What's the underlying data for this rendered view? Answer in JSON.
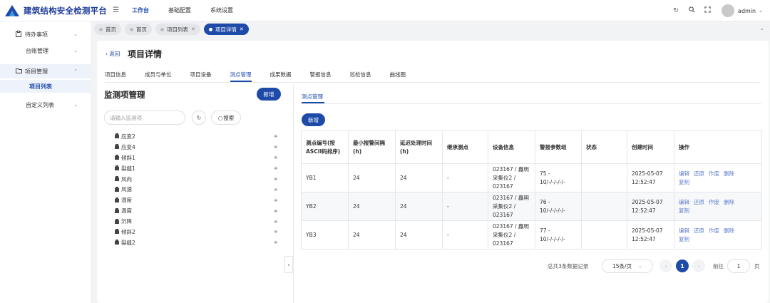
{
  "header": {
    "brand": "建筑结构安全检测平台",
    "nav": [
      "工作台",
      "基础配置",
      "系统设置"
    ],
    "username": "admin",
    "colors": {
      "primary": "#1f4ba8",
      "brand_text": "#1f3d9c"
    }
  },
  "sidebar": {
    "items": [
      {
        "label": "待办事项",
        "icon": "clipboard-icon"
      },
      {
        "label": "台账管理"
      },
      {
        "label": "项目管理",
        "icon": "folder-icon"
      },
      {
        "label": "项目列表"
      },
      {
        "label": "自定义列表"
      }
    ]
  },
  "tags": [
    {
      "label": "首页"
    },
    {
      "label": "首页"
    },
    {
      "label": "项目列表"
    },
    {
      "label": "项目详情"
    }
  ],
  "page": {
    "back_label": "返回",
    "title": "项目详情",
    "tabs": [
      "项目信息",
      "成员与单位",
      "项目设备",
      "测点管理",
      "成果数据",
      "警报信息",
      "巡检信息",
      "曲线图"
    ]
  },
  "left_panel": {
    "title": "监测项管理",
    "add_label": "新增",
    "search_placeholder": "请输入监测项",
    "search_label": "搜索",
    "tree": [
      "应变2",
      "应变4",
      "倾斜1",
      "裂缝1",
      "风向",
      "风速",
      "湿度",
      "温度",
      "沉降",
      "倾斜2",
      "裂缝2"
    ]
  },
  "right_panel": {
    "tab": "测点管理",
    "add_label": "新增",
    "columns": [
      "测点编号(按ASCII码排序)",
      "最小报警间隔(h)",
      "延迟处理时间(h)",
      "继承测点",
      "设备信息",
      "警报参数组",
      "状态",
      "创建时间",
      "操作"
    ],
    "rows": [
      {
        "code": "YB1",
        "min_interval": "24",
        "delay": "24",
        "inherit": "-",
        "device": "023167 / 矗明采集仪2 / 023167",
        "params": "75 - 10/-/-/-/-/-",
        "status": "",
        "created": "2025-05-07 12:52:47"
      },
      {
        "code": "YB2",
        "min_interval": "24",
        "delay": "24",
        "inherit": "-",
        "device": "023167 / 矗明采集仪2 / 023167",
        "params": "76 - 10/-/-/-/-/-",
        "status": "",
        "created": "2025-05-07 12:52:47"
      },
      {
        "code": "YB3",
        "min_interval": "24",
        "delay": "24",
        "inherit": "-",
        "device": "023167 / 矗明采集仪2 / 023167",
        "params": "77 - 10/-/-/-/-/-",
        "status": "",
        "created": "2025-05-07 12:52:47"
      }
    ],
    "ops": [
      "编辑",
      "还原",
      "作废",
      "删除",
      "复制"
    ],
    "pagination": {
      "total": "总共3条数据记录",
      "page_size": "15条/页",
      "current": "1",
      "goto_prefix": "前往",
      "goto_value": "1",
      "goto_suffix": "页"
    }
  }
}
